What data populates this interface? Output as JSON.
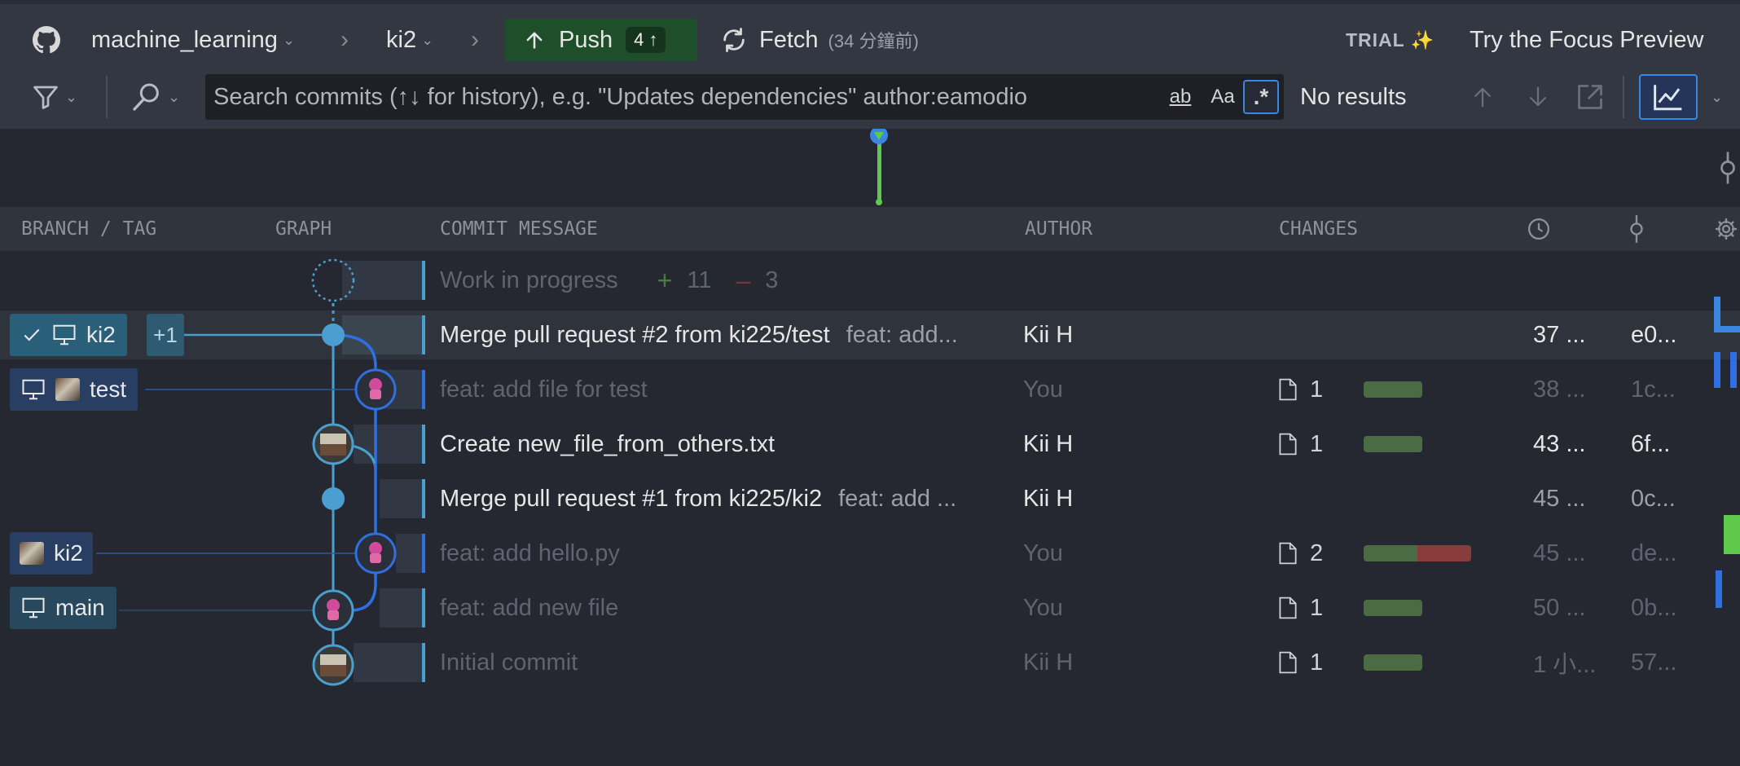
{
  "header": {
    "repo": "machine_learning",
    "branch": "ki2",
    "push_label": "Push",
    "push_count": "4 ↑",
    "fetch_label": "Fetch",
    "fetch_time": "(34 分鐘前)",
    "trial_label": "TRIAL ✨",
    "focus_label": "Try the Focus Preview"
  },
  "search": {
    "placeholder": "Search commits (↑↓ for history), e.g. \"Updates dependencies\" author:eamodio",
    "opt_word": "ab",
    "opt_case": "Aa",
    "opt_regex": ".*",
    "results": "No results"
  },
  "columns": {
    "branch": "BRANCH / TAG",
    "graph": "GRAPH",
    "message": "COMMIT MESSAGE",
    "author": "AUTHOR",
    "changes": "CHANGES"
  },
  "wip": {
    "label": "Work in progress",
    "added": "11",
    "removed": "3"
  },
  "refs": {
    "ki2_current": "ki2",
    "plus_one": "+1",
    "test": "test",
    "ki2_remote": "ki2",
    "main": "main"
  },
  "commits": [
    {
      "message": "Merge pull request #2 from ki225/test",
      "desc": "feat: add...",
      "author": "Kii H",
      "files": "",
      "date": "37 ...",
      "sha": "e0..."
    },
    {
      "message": "feat: add file for test",
      "desc": "",
      "author": "You",
      "files": "1",
      "date": "38 ...",
      "sha": "1c..."
    },
    {
      "message": "Create new_file_from_others.txt",
      "desc": "",
      "author": "Kii H",
      "files": "1",
      "date": "43 ...",
      "sha": "6f..."
    },
    {
      "message": "Merge pull request #1 from ki225/ki2",
      "desc": "feat: add ...",
      "author": "Kii H",
      "files": "",
      "date": "45 ...",
      "sha": "0c..."
    },
    {
      "message": "feat: add hello.py",
      "desc": "",
      "author": "You",
      "files": "2",
      "date": "45 ...",
      "sha": "de..."
    },
    {
      "message": "feat: add new file",
      "desc": "",
      "author": "You",
      "files": "1",
      "date": "50 ...",
      "sha": "0b..."
    },
    {
      "message": "Initial commit",
      "desc": "",
      "author": "Kii H",
      "files": "1",
      "date": "1 小...",
      "sha": "57..."
    }
  ],
  "colors": {
    "accent": "#3a86e0",
    "graph_lane_1": "#4a9fd0",
    "graph_lane_2": "#2f6fe0",
    "push_bg": "#1f4f2a",
    "added": "#4a6b44",
    "deleted": "#8a3b3b"
  }
}
